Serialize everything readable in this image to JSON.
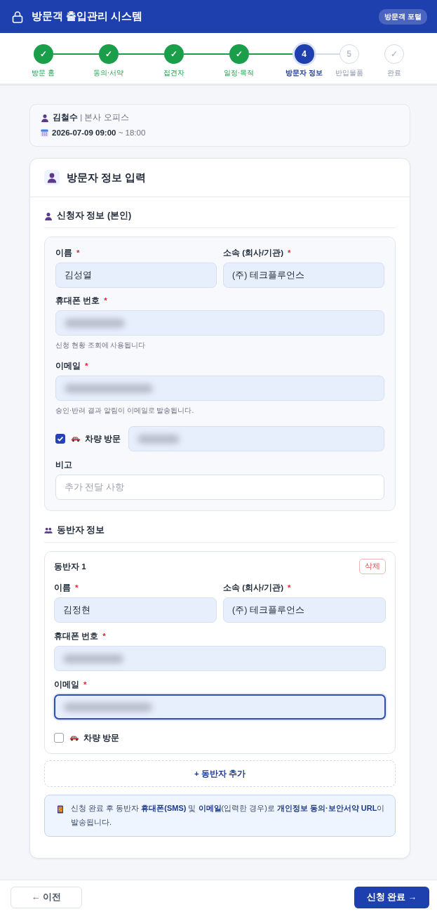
{
  "header": {
    "title": "방문객 출입관리 시스템",
    "badge": "방문객 포털"
  },
  "steps": [
    {
      "marker": "✓",
      "label": "방문 홈",
      "completed": true,
      "selected": false
    },
    {
      "marker": "✓",
      "label": "동의·서약",
      "completed": true,
      "selected": false
    },
    {
      "marker": "✓",
      "label": "접견자",
      "completed": true,
      "selected": false
    },
    {
      "marker": "✓",
      "label": "일정·목적",
      "completed": true,
      "selected": false
    },
    {
      "marker": "4",
      "label": "방문자 정보",
      "completed": false,
      "selected": true
    },
    {
      "marker": "5",
      "label": "반입물품",
      "completed": false,
      "selected": false
    },
    {
      "marker": "✓",
      "label": "완료",
      "completed": false,
      "selected": false
    }
  ],
  "summary": {
    "host": "**김철수** | 본사 오피스",
    "schedule": "**2026-07-09 09:00** ~ 18:00"
  },
  "form": {
    "title": "방문자 정보 입력",
    "applicant": {
      "title": "신청자 정보 (본인)",
      "rows": [
        {
          "kind": "fields",
          "fields": [
            {
              "kind": "text",
              "label": "이름",
              "required_mark": "*",
              "value": "김성열",
              "autofilled": true,
              "focused": false
            },
            {
              "kind": "text",
              "label": "소속 (회사/기관)",
              "required_mark": "*",
              "value": "(주) 테크플루언스",
              "autofilled": true,
              "focused": false
            }
          ]
        },
        {
          "kind": "fields",
          "fields": [
            {
              "kind": "tel",
              "label": "휴대폰 번호",
              "required_mark": "*",
              "autofilled": true,
              "focused": false,
              "hint": "신청 현황 조회에 사용됩니다"
            }
          ]
        },
        {
          "kind": "fields",
          "fields": [
            {
              "kind": "email",
              "label": "이메일",
              "required_mark": "*",
              "autofilled": true,
              "focused": false,
              "hint": "승인·반려 결과 알림이 이메일로 발송됩니다."
            }
          ]
        },
        {
          "kind": "checkbox",
          "label": "차량 방문",
          "checked": true,
          "field": {
            "kind": "plate",
            "autofilled": true,
            "focused": false
          }
        },
        {
          "kind": "fields",
          "fields": [
            {
              "kind": "text",
              "label": "비고",
              "placeholder": "추가 전달 사항",
              "autofilled": false,
              "focused": false
            }
          ]
        }
      ]
    },
    "companions": {
      "title": "동반자 정보",
      "items": [
        {
          "title": "동반자 1",
          "delete_label": "삭제",
          "rows": [
            {
              "kind": "fields",
              "fields": [
                {
                  "kind": "text",
                  "label": "이름",
                  "required_mark": "*",
                  "value": "김정현",
                  "autofilled": true,
                  "focused": false
                },
                {
                  "kind": "text",
                  "label": "소속 (회사/기관)",
                  "required_mark": "*",
                  "value": "(주) 테크플루언스",
                  "autofilled": true,
                  "focused": false
                }
              ]
            },
            {
              "kind": "fields",
              "fields": [
                {
                  "kind": "tel",
                  "label": "휴대폰 번호",
                  "required_mark": "*",
                  "autofilled": true,
                  "focused": false
                }
              ]
            },
            {
              "kind": "fields",
              "fields": [
                {
                  "kind": "email",
                  "label": "이메일",
                  "required_mark": "*",
                  "autofilled": true,
                  "focused": true
                }
              ]
            },
            {
              "kind": "checkbox",
              "label": "차량 방문",
              "checked": false
            }
          ]
        }
      ],
      "add_label": "+ 동반자 추가"
    },
    "notice": "신청 완료 후 동반자 **휴대폰(SMS)** 및 **이메일**(입력한 경우)로 **개인정보 동의·보안서약 URL**이 발송됩니다."
  },
  "footer": {
    "prev": "← 이전",
    "submit": "신청 완료 →"
  }
}
